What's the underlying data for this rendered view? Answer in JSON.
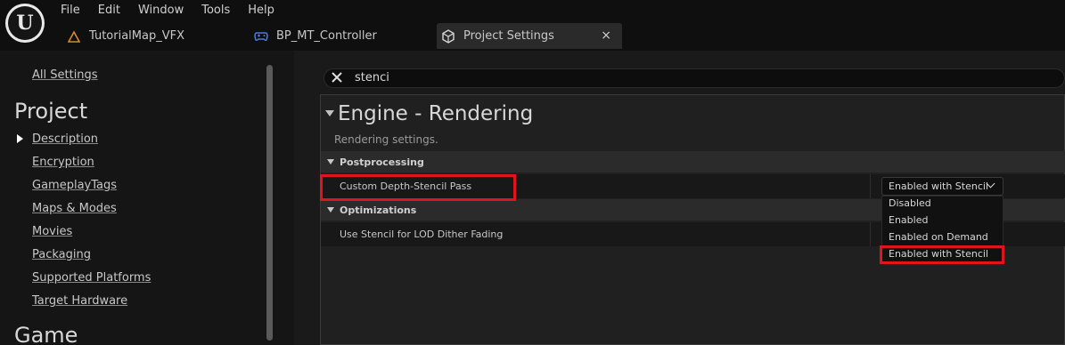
{
  "menu": [
    "File",
    "Edit",
    "Window",
    "Tools",
    "Help"
  ],
  "tabs": [
    {
      "label": "TutorialMap_VFX",
      "icon": "level-icon",
      "active": false
    },
    {
      "label": "BP_MT_Controller",
      "icon": "gamepad-icon",
      "active": false
    },
    {
      "label": "Project Settings",
      "icon": "settings-cube-icon",
      "active": true,
      "close": "×"
    }
  ],
  "sidebar": {
    "all_settings": "All Settings",
    "project_heading": "Project",
    "items": [
      "Description",
      "Encryption",
      "GameplayTags",
      "Maps & Modes",
      "Movies",
      "Packaging",
      "Supported Platforms",
      "Target Hardware"
    ],
    "game_heading": "Game"
  },
  "search": {
    "value": "stenci"
  },
  "section": {
    "title": "Engine - Rendering",
    "subtitle": "Rendering settings."
  },
  "categories": [
    {
      "label": "Postprocessing",
      "properties": [
        {
          "label": "Custom Depth-Stencil Pass",
          "value": "Enabled with Stencil"
        }
      ]
    },
    {
      "label": "Optimizations",
      "properties": [
        {
          "label": "Use Stencil for LOD Dither Fading"
        }
      ]
    }
  ],
  "dropdown_options": [
    "Disabled",
    "Enabled",
    "Enabled on Demand",
    "Enabled with Stencil"
  ],
  "colors": {
    "highlight": "#e0141c",
    "accent_blue": "#4a7bd8",
    "level_orange": "#d88a2a"
  }
}
